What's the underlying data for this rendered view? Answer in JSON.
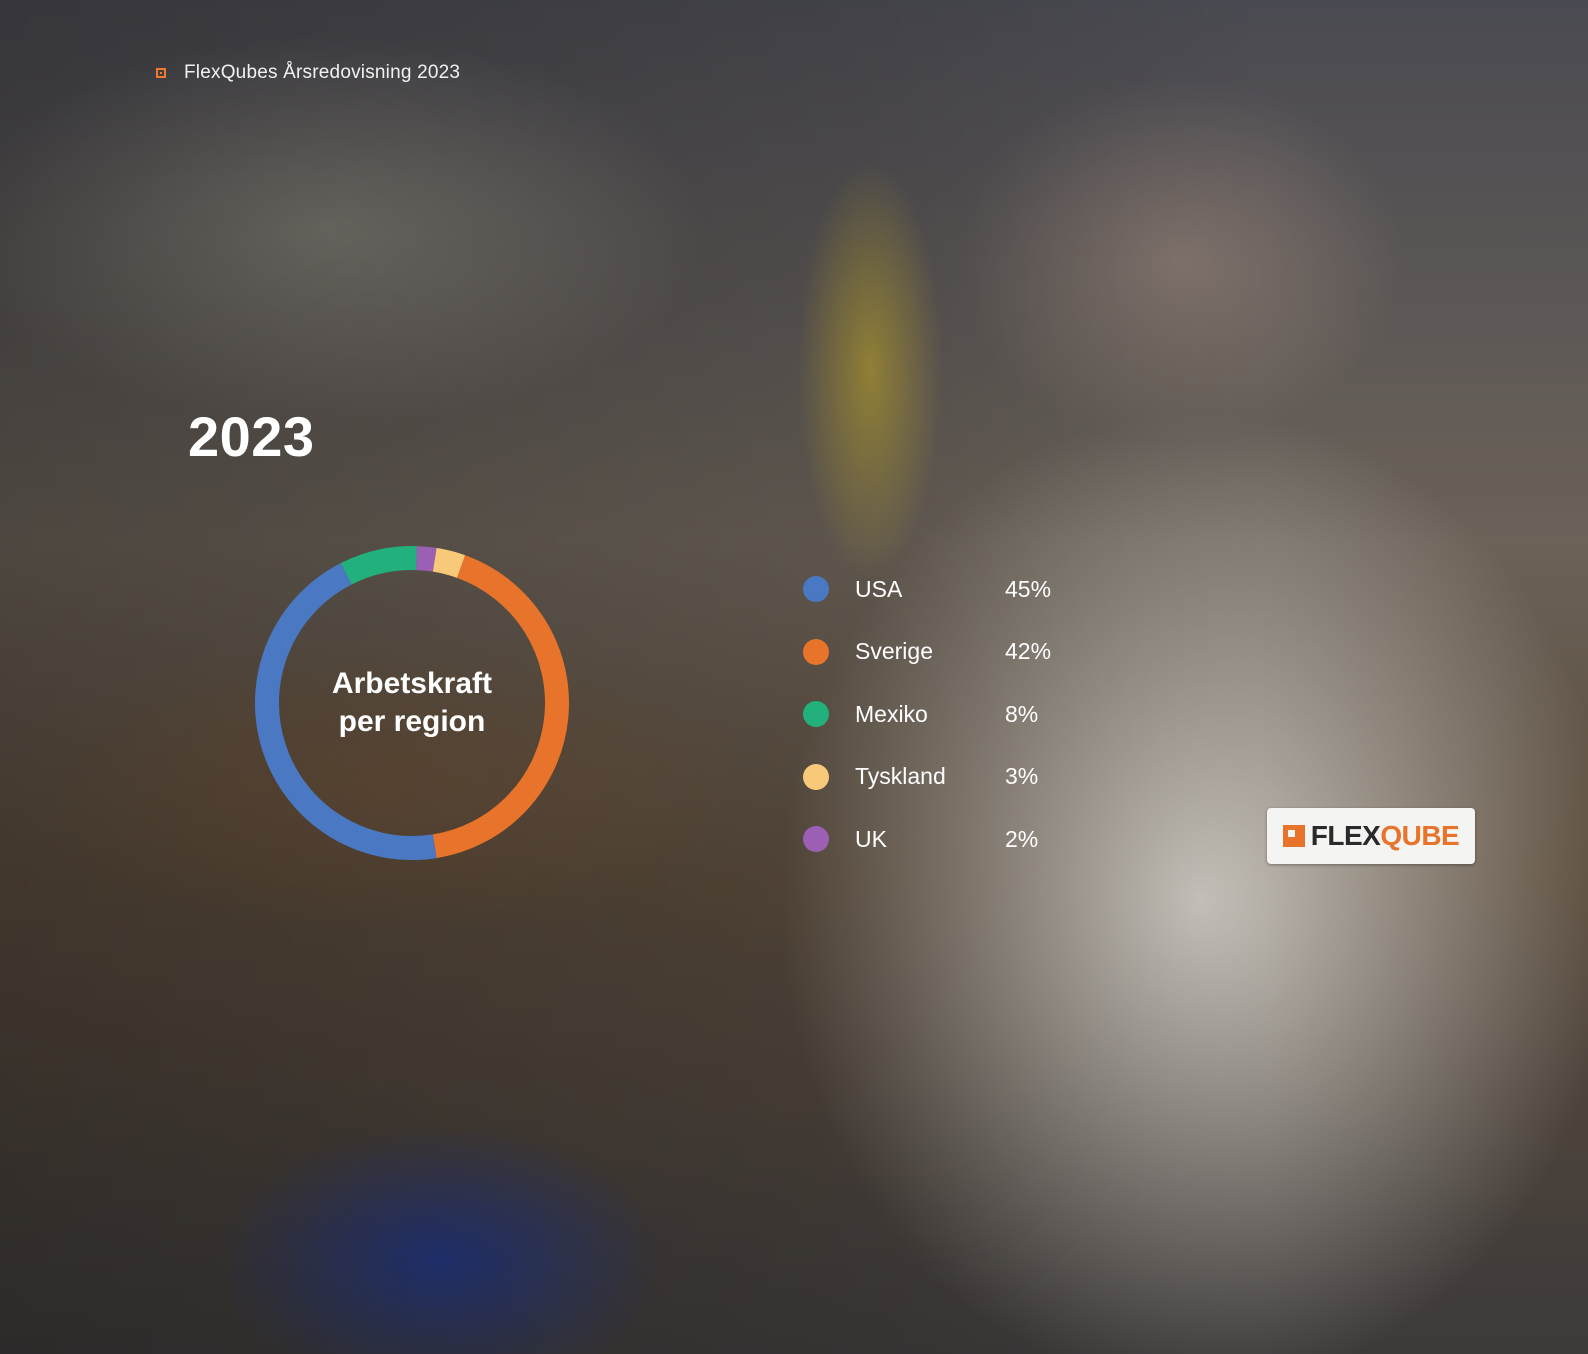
{
  "header": {
    "title": "FlexQubes Årsredovisning 2023"
  },
  "year": "2023",
  "chart_data": {
    "type": "pie",
    "title": "Arbetskraft per region",
    "title_lines": [
      "Arbetskraft",
      "per region"
    ],
    "style": "donut",
    "legend_position": "right",
    "series": [
      {
        "name": "USA",
        "value": 45,
        "label": "45%",
        "color": "#4a78c2"
      },
      {
        "name": "Sverige",
        "value": 42,
        "label": "42%",
        "color": "#e8732a"
      },
      {
        "name": "Mexiko",
        "value": 8,
        "label": "8%",
        "color": "#22b07c"
      },
      {
        "name": "Tyskland",
        "value": 3,
        "label": "3%",
        "color": "#f8c978"
      },
      {
        "name": "UK",
        "value": 2,
        "label": "2%",
        "color": "#9b5fb3"
      }
    ],
    "draw_order": [
      "Tyskland",
      "Sverige",
      "USA",
      "Mexiko",
      "UK"
    ]
  },
  "logo": {
    "flex": "FLEX",
    "qube": "QUBE"
  }
}
